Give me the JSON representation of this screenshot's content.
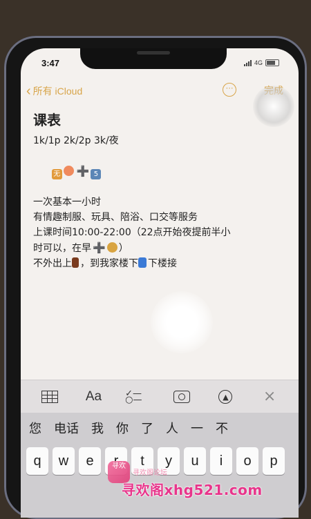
{
  "status_bar": {
    "time": "3:47",
    "network": "4G"
  },
  "nav": {
    "back_label": "所有 iCloud",
    "more_label": "⋯",
    "done_label": "完成"
  },
  "note": {
    "title": "课表",
    "line1": "1k/1p 2k/2p 3k/夜",
    "line2_plus": "➕",
    "line2_num": "5",
    "line3": "一次基本一小时",
    "line4": "有情趣制服、玩具、陪浴、口交等服务",
    "line5": "上课时间10:00-22:00（22点开始夜提前半小",
    "line6_a": "时可以，在早",
    "line6_plus": "➕",
    "line6_b": "）",
    "line7_a": "不外出上",
    "line7_b": "，到我家楼下",
    "line7_c": "下楼接"
  },
  "toolbar": {
    "format_label": "Aa",
    "close_label": "×"
  },
  "keyboard": {
    "candidates": [
      "您",
      "电话",
      "我",
      "你",
      "了",
      "人",
      "一",
      "不"
    ],
    "row1": [
      "q",
      "w",
      "e",
      "r",
      "t",
      "y",
      "u",
      "i",
      "o",
      "p"
    ]
  },
  "watermark": {
    "small_text": "寻欢阁论坛",
    "main_text": "寻欢阁xhg521.com"
  },
  "colors": {
    "accent": "#d8a54a",
    "watermark": "#e8358b"
  }
}
